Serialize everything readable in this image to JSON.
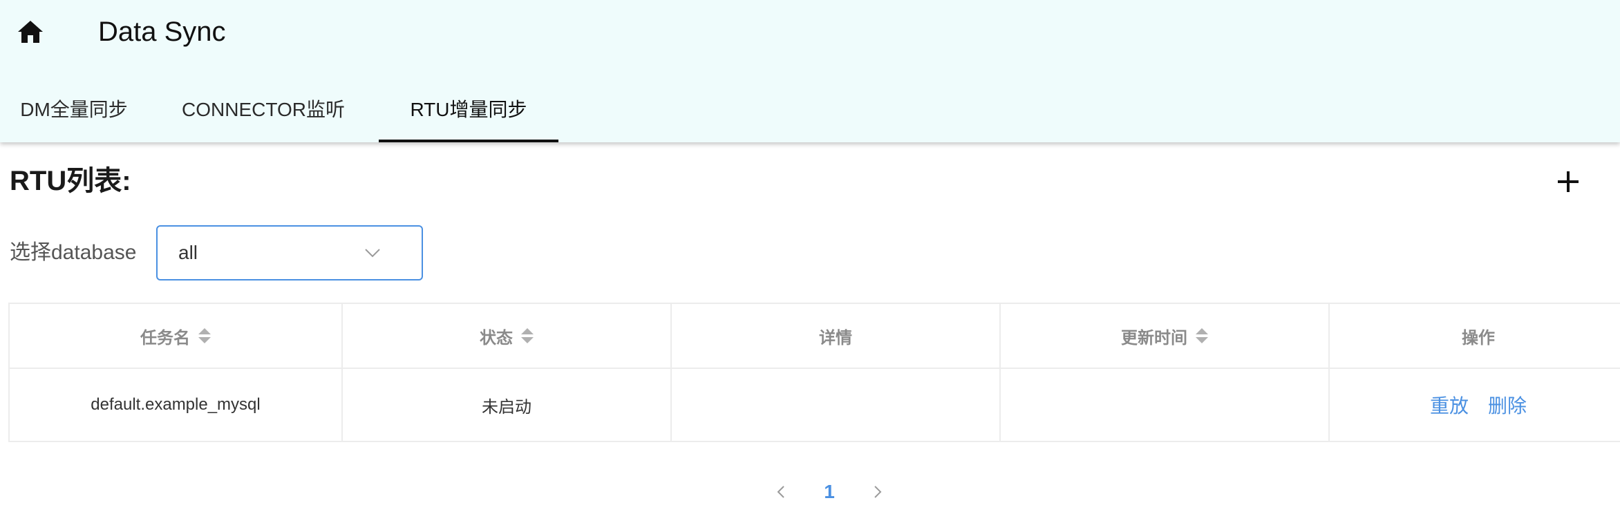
{
  "header": {
    "title": "Data Sync",
    "home_icon": "home-icon"
  },
  "tabs": [
    {
      "label": "DM全量同步",
      "active": false
    },
    {
      "label": "CONNECTOR监听",
      "active": false
    },
    {
      "label": "RTU增量同步",
      "active": true
    }
  ],
  "main": {
    "list_title": "RTU列表:",
    "add_icon": "plus-icon",
    "filter": {
      "label": "选择database",
      "selected": "all",
      "icon": "chevron-down-icon"
    }
  },
  "table": {
    "columns": [
      "任务名",
      "状态",
      "详情",
      "更新时间",
      "操作"
    ],
    "rows": [
      {
        "task_name": "default.example_mysql",
        "status": "未启动",
        "details": "",
        "updated_at": "",
        "actions": [
          "重放",
          "删除"
        ]
      }
    ]
  },
  "pagination": {
    "current_page": "1",
    "prev_icon": "chevron-left-icon",
    "next_icon": "chevron-right-icon"
  },
  "colors": {
    "appbar_bg": "#effcfc",
    "accent": "#4a90e2"
  }
}
